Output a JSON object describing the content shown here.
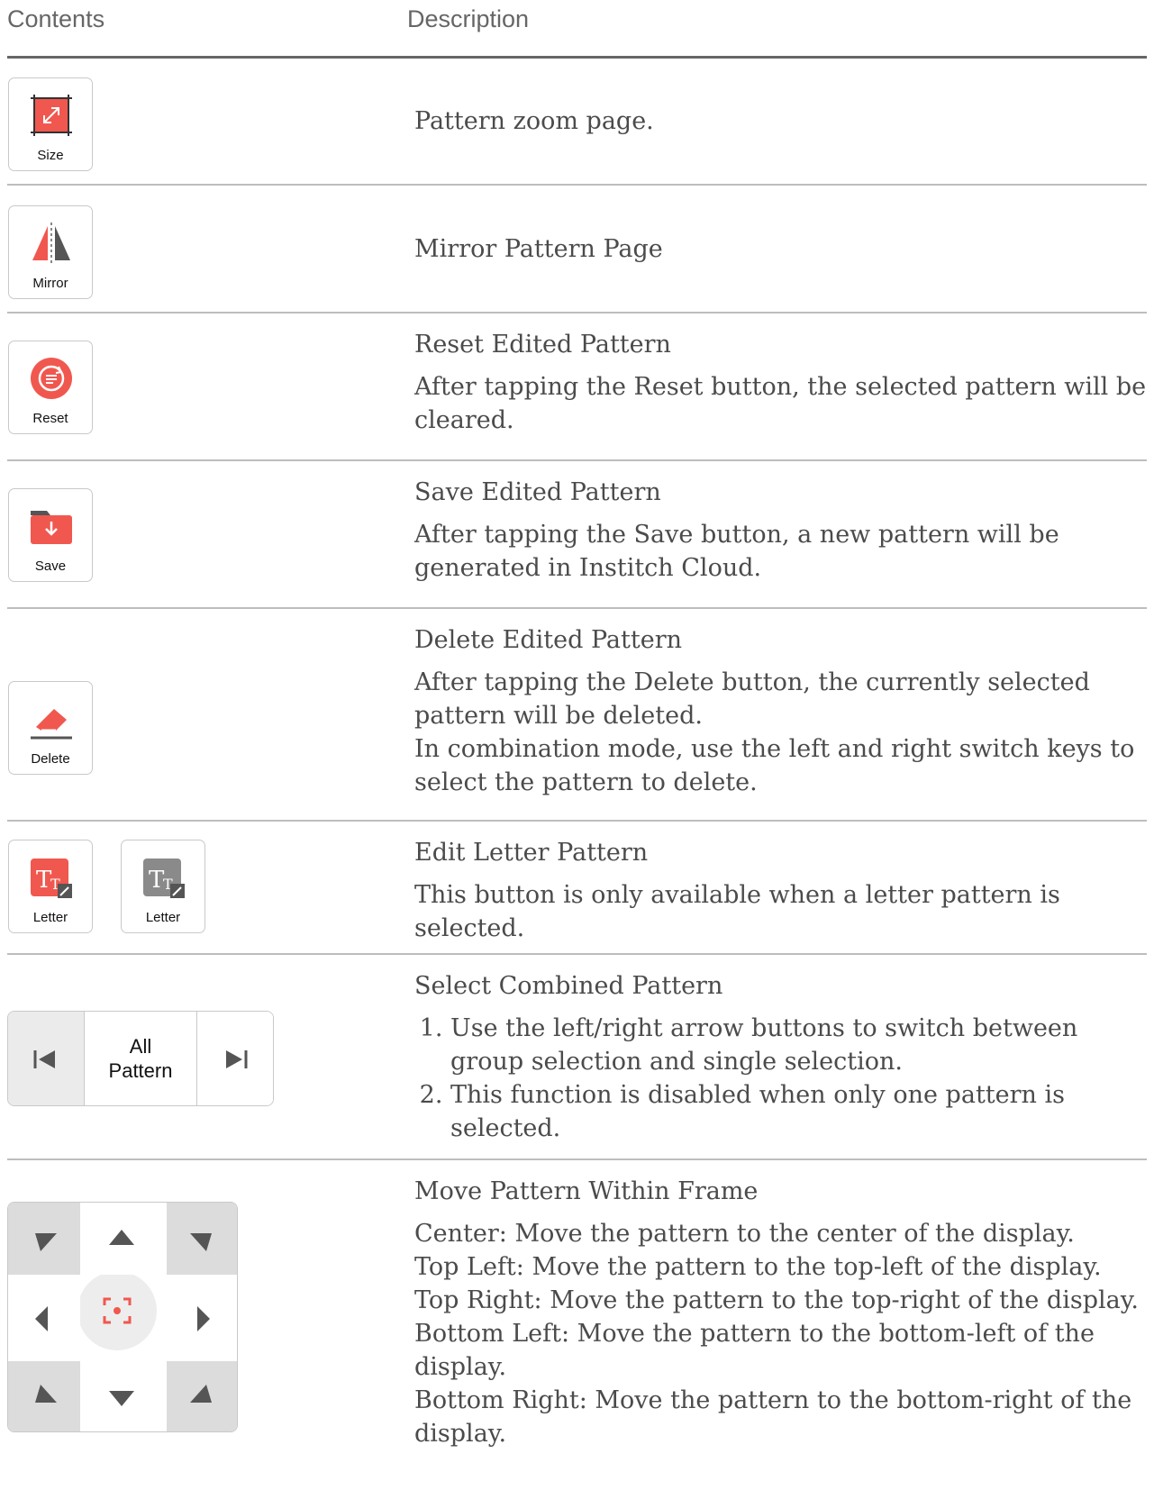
{
  "header": {
    "contents": "Contents",
    "description": "Description"
  },
  "rows": [
    {
      "icon_label": "Size",
      "icon": "resize-icon",
      "title": "Pattern zoom page."
    },
    {
      "icon_label": "Mirror",
      "icon": "mirror-icon",
      "title": "Mirror Pattern Page"
    },
    {
      "icon_label": "Reset",
      "icon": "reset-icon",
      "title": "Reset Edited Pattern",
      "text": "After tapping the Reset button, the selected pattern will be cleared."
    },
    {
      "icon_label": "Save",
      "icon": "save-folder-icon",
      "title": "Save Edited Pattern",
      "text": "After tapping the Save button, a new pattern will be generated in Institch Cloud."
    },
    {
      "icon_label": "Delete",
      "icon": "eraser-icon",
      "title": "Delete Edited Pattern",
      "text1": "After tapping the Delete button, the currently selected pattern will be deleted.",
      "text2": "In combination mode, use the left and right switch keys to select the pattern to delete."
    },
    {
      "icon_label_1": "Letter",
      "icon_label_2": "Letter",
      "icon": "letter-edit-icon",
      "title": "Edit Letter Pattern",
      "text": "This button is only available when a letter pattern is selected."
    },
    {
      "selector_label_1": "All",
      "selector_label_2": "Pattern",
      "title": "Select Combined Pattern",
      "items": [
        "Use the left/right arrow buttons to switch between group selection and single selection.",
        "This function is disabled when only one pattern is selected."
      ]
    },
    {
      "title": "Move Pattern Within Frame",
      "lines": [
        "Center: Move the pattern to the center of the display.",
        "Top Left: Move the pattern to the top-left of the display.",
        "Top Right: Move the pattern to the top-right of the display.",
        "Bottom Left: Move the pattern to the bottom-left of the display.",
        "Bottom Right: Move the pattern to the bottom-right of the display."
      ]
    }
  ],
  "colors": {
    "accent": "#f0584f",
    "text": "#4b4b4b",
    "gray_icon": "#8a8a8a"
  }
}
